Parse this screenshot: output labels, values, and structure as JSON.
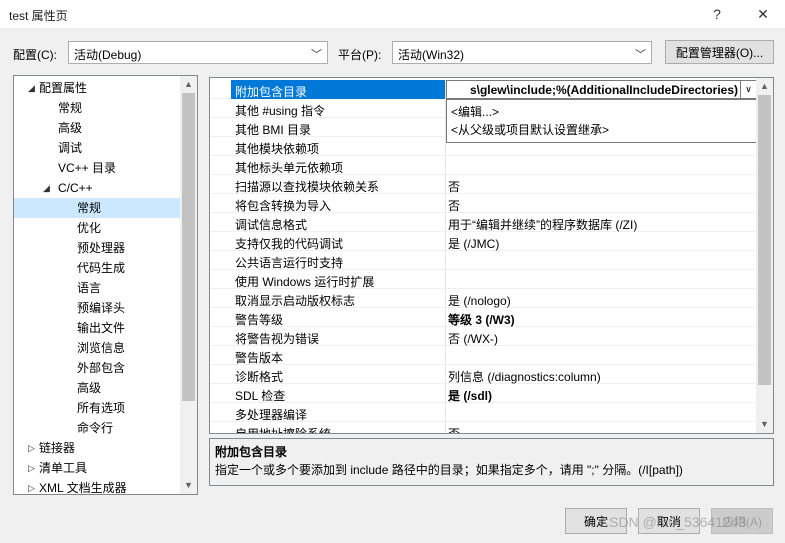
{
  "window": {
    "title": "test 属性页",
    "help_glyph": "?",
    "close_glyph": "✕"
  },
  "config": {
    "config_label": "配置(C):",
    "config_value": "活动(Debug)",
    "platform_label": "平台(P):",
    "platform_value": "活动(Win32)",
    "manager_button": "配置管理器(O)..."
  },
  "tree": {
    "items": [
      {
        "label": "配置属性",
        "arrow": "◢"
      },
      {
        "label": "常规"
      },
      {
        "label": "高级"
      },
      {
        "label": "调试"
      },
      {
        "label": "VC++ 目录"
      },
      {
        "label": "C/C++",
        "arrow": "◢"
      },
      {
        "label": "常规",
        "selected": true
      },
      {
        "label": "优化"
      },
      {
        "label": "预处理器"
      },
      {
        "label": "代码生成"
      },
      {
        "label": "语言"
      },
      {
        "label": "预编译头"
      },
      {
        "label": "输出文件"
      },
      {
        "label": "浏览信息"
      },
      {
        "label": "外部包含"
      },
      {
        "label": "高级"
      },
      {
        "label": "所有选项"
      },
      {
        "label": "命令行"
      },
      {
        "label": "链接器",
        "arrow": "▷"
      },
      {
        "label": "清单工具",
        "arrow": "▷"
      },
      {
        "label": "XML 文档生成器",
        "arrow": "▷"
      }
    ]
  },
  "grid": {
    "editor_value": "s\\glew\\include;%(AdditionalIncludeDirectories)",
    "dropdown_options": [
      "<编辑...>",
      "<从父级或项目默认设置继承>"
    ],
    "rows": [
      {
        "name": "附加包含目录",
        "value": "",
        "selected": true
      },
      {
        "name": "其他 #using 指令",
        "value": ""
      },
      {
        "name": "其他 BMI 目录",
        "value": ""
      },
      {
        "name": "其他模块依赖项",
        "value": ""
      },
      {
        "name": "其他标头单元依赖项",
        "value": ""
      },
      {
        "name": "扫描源以查找模块依赖关系",
        "value": "否"
      },
      {
        "name": "将包含转换为导入",
        "value": "否"
      },
      {
        "name": "调试信息格式",
        "value": "用于“编辑并继续”的程序数据库 (/ZI)"
      },
      {
        "name": "支持仅我的代码调试",
        "value": "是 (/JMC)"
      },
      {
        "name": "公共语言运行时支持",
        "value": ""
      },
      {
        "name": "使用 Windows 运行时扩展",
        "value": ""
      },
      {
        "name": "取消显示启动版权标志",
        "value": "是 (/nologo)"
      },
      {
        "name": "警告等级",
        "value": "等级 3 (/W3)",
        "bold": true
      },
      {
        "name": "将警告视为错误",
        "value": "否 (/WX-)"
      },
      {
        "name": "警告版本",
        "value": ""
      },
      {
        "name": "诊断格式",
        "value": "列信息 (/diagnostics:column)"
      },
      {
        "name": "SDL 检查",
        "value": "是 (/sdl)",
        "bold": true
      },
      {
        "name": "多处理器编译",
        "value": ""
      },
      {
        "name": "启用地址擦除系统",
        "value": "否"
      }
    ]
  },
  "description": {
    "title": "附加包含目录",
    "text": "指定一个或多个要添加到 include 路径中的目录；如果指定多个，请用 \";\" 分隔。(/I[path])"
  },
  "buttons": {
    "ok": "确定",
    "cancel": "取消",
    "apply": "应用(A)"
  },
  "watermark": "CSDN @m0_53641243"
}
